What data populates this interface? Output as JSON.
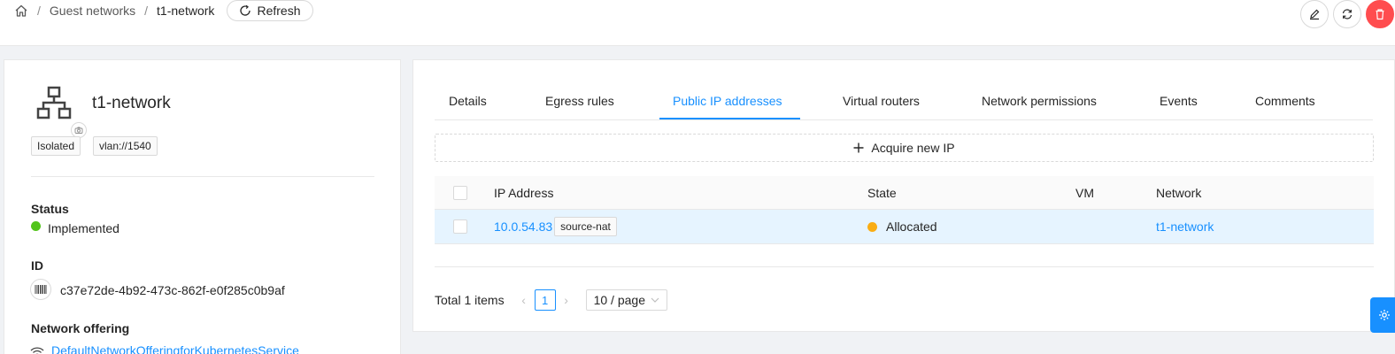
{
  "breadcrumb": {
    "items": [
      "Guest networks",
      "t1-network"
    ],
    "separator": "/"
  },
  "toolbar": {
    "refresh_label": "Refresh"
  },
  "network": {
    "name": "t1-network",
    "tags": [
      "Isolated",
      "vlan://1540"
    ],
    "status_label": "Status",
    "status_value": "Implemented",
    "id_label": "ID",
    "id_value": "c37e72de-4b92-473c-862f-e0f285c0b9af",
    "offering_label": "Network offering",
    "offering_value": "DefaultNetworkOfferingforKubernetesService"
  },
  "tabs": [
    {
      "label": "Details"
    },
    {
      "label": "Egress rules"
    },
    {
      "label": "Public IP addresses",
      "active": true
    },
    {
      "label": "Virtual routers"
    },
    {
      "label": "Network permissions"
    },
    {
      "label": "Events"
    },
    {
      "label": "Comments"
    }
  ],
  "acquire_label": "Acquire new IP",
  "table": {
    "columns": [
      "IP Address",
      "State",
      "VM",
      "Network"
    ],
    "rows": [
      {
        "ip": "10.0.54.83",
        "tag": "source-nat",
        "state": "Allocated",
        "vm": "",
        "network": "t1-network"
      }
    ]
  },
  "pagination": {
    "total_text": "Total 1 items",
    "current_page": "1",
    "page_size": "10 / page"
  },
  "colors": {
    "primary": "#1890ff",
    "success": "#52c41a",
    "warning": "#faad14",
    "danger": "#ff4d4f"
  }
}
